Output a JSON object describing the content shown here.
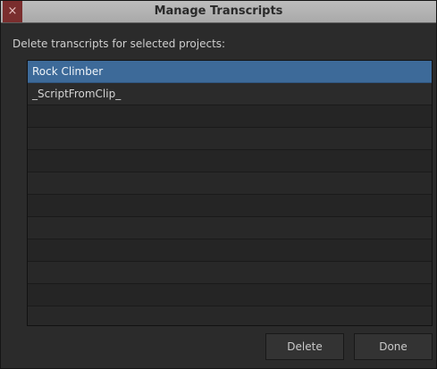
{
  "window": {
    "title": "Manage Transcripts",
    "close_glyph": "×"
  },
  "instruction": "Delete transcripts for selected projects:",
  "projects": [
    {
      "label": "Rock Climber",
      "selected": true
    },
    {
      "label": "_ScriptFromClip_",
      "selected": false
    }
  ],
  "buttons": {
    "delete_label": "Delete",
    "done_label": "Done"
  },
  "colors": {
    "selection": "#3d6a99",
    "close_button": "#7a2e2e"
  },
  "icons": {
    "close": "close-icon"
  }
}
